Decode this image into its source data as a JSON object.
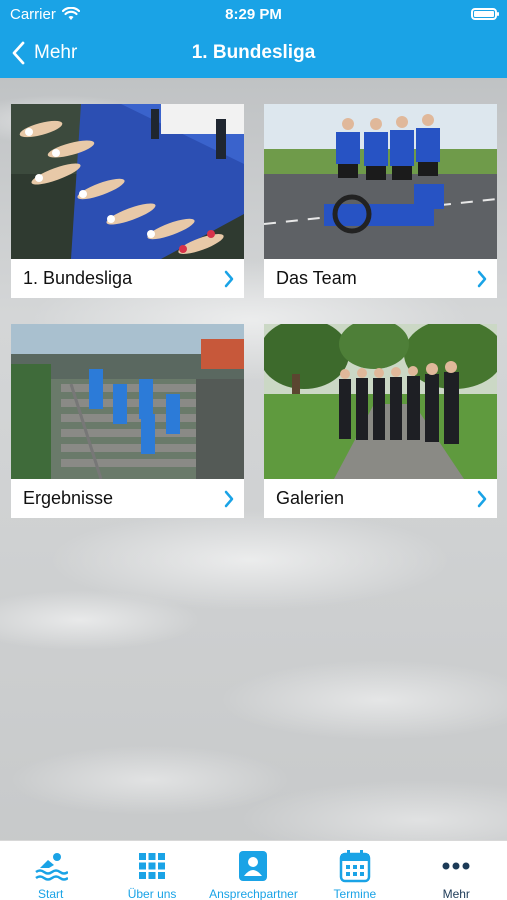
{
  "status": {
    "carrier": "Carrier",
    "time": "8:29 PM"
  },
  "nav": {
    "back_label": "Mehr",
    "title": "1. Bundesliga"
  },
  "tiles": [
    {
      "label": "1. Bundesliga"
    },
    {
      "label": "Das Team"
    },
    {
      "label": "Ergebnisse"
    },
    {
      "label": "Galerien"
    }
  ],
  "tabs": [
    {
      "label": "Start",
      "icon": "swimmer-icon"
    },
    {
      "label": "Über uns",
      "icon": "grid-icon"
    },
    {
      "label": "Ansprechpartner",
      "icon": "contact-card-icon"
    },
    {
      "label": "Termine",
      "icon": "calendar-icon"
    },
    {
      "label": "Mehr",
      "icon": "more-dots-icon"
    }
  ],
  "colors": {
    "accent": "#1aa3e6",
    "active_tab": "#1c3a57"
  }
}
